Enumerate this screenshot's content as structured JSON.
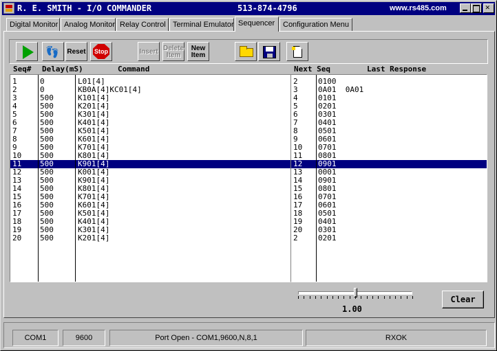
{
  "window": {
    "title": "R. E. SMITH - I/O COMMANDER",
    "phone": "513-874-4796",
    "website": "www.rs485.com"
  },
  "tabs": [
    {
      "label": "Digital Monitor"
    },
    {
      "label": "Analog Monitor"
    },
    {
      "label": "Relay Control"
    },
    {
      "label": "Terminal Emulator"
    },
    {
      "label": "Sequencer",
      "active": true
    },
    {
      "label": "Configuration Menu"
    }
  ],
  "toolbar": {
    "reset": "Reset",
    "stop": "Stop",
    "insert": "Insert",
    "delete_line1": "Delete",
    "delete_line2": "Item",
    "new_line1": "New",
    "new_line2": "Item",
    "icons": {
      "run": "play-icon",
      "step": "footsteps-icon",
      "stop": "stop-sign-icon",
      "open": "folder-open-icon",
      "save": "floppy-disk-icon",
      "new_file": "new-document-icon"
    },
    "colors": {
      "run": "#00a000",
      "stop": "#d00000"
    }
  },
  "headers": {
    "seq": "Seq#",
    "delay": "Delay(mS)",
    "command": "Command",
    "next_seq": "Next Seq",
    "last_response": "Last Response"
  },
  "rows": [
    {
      "seq": "1",
      "delay": "0",
      "command": "L01[4]",
      "next": "2",
      "response": "0100"
    },
    {
      "seq": "2",
      "delay": "0",
      "command": "KB0A[4]KC01[4]",
      "next": "3",
      "response": "0A01  0A01"
    },
    {
      "seq": "3",
      "delay": "500",
      "command": "K101[4]",
      "next": "4",
      "response": "0101"
    },
    {
      "seq": "4",
      "delay": "500",
      "command": "K201[4]",
      "next": "5",
      "response": "0201"
    },
    {
      "seq": "5",
      "delay": "500",
      "command": "K301[4]",
      "next": "6",
      "response": "0301"
    },
    {
      "seq": "6",
      "delay": "500",
      "command": "K401[4]",
      "next": "7",
      "response": "0401"
    },
    {
      "seq": "7",
      "delay": "500",
      "command": "K501[4]",
      "next": "8",
      "response": "0501"
    },
    {
      "seq": "8",
      "delay": "500",
      "command": "K601[4]",
      "next": "9",
      "response": "0601"
    },
    {
      "seq": "9",
      "delay": "500",
      "command": "K701[4]",
      "next": "10",
      "response": "0701"
    },
    {
      "seq": "10",
      "delay": "500",
      "command": "K801[4]",
      "next": "11",
      "response": "0801"
    },
    {
      "seq": "11",
      "delay": "500",
      "command": "K901[4]",
      "next": "12",
      "response": "0901",
      "selected": true
    },
    {
      "seq": "12",
      "delay": "500",
      "command": "K001[4]",
      "next": "13",
      "response": "0001"
    },
    {
      "seq": "13",
      "delay": "500",
      "command": "K901[4]",
      "next": "14",
      "response": "0901"
    },
    {
      "seq": "14",
      "delay": "500",
      "command": "K801[4]",
      "next": "15",
      "response": "0801"
    },
    {
      "seq": "15",
      "delay": "500",
      "command": "K701[4]",
      "next": "16",
      "response": "0701"
    },
    {
      "seq": "16",
      "delay": "500",
      "command": "K601[4]",
      "next": "17",
      "response": "0601"
    },
    {
      "seq": "17",
      "delay": "500",
      "command": "K501[4]",
      "next": "18",
      "response": "0501"
    },
    {
      "seq": "18",
      "delay": "500",
      "command": "K401[4]",
      "next": "19",
      "response": "0401"
    },
    {
      "seq": "19",
      "delay": "500",
      "command": "K301[4]",
      "next": "20",
      "response": "0301"
    },
    {
      "seq": "20",
      "delay": "500",
      "command": "K201[4]",
      "next": "2",
      "response": "0201"
    }
  ],
  "speed": {
    "value": "1.00",
    "position": 0.49
  },
  "clear_button": "Clear",
  "status": {
    "port": "COM1",
    "baud": "9600",
    "message": "Port Open - COM1,9600,N,8,1",
    "empty": "",
    "rx": "RXOK"
  }
}
